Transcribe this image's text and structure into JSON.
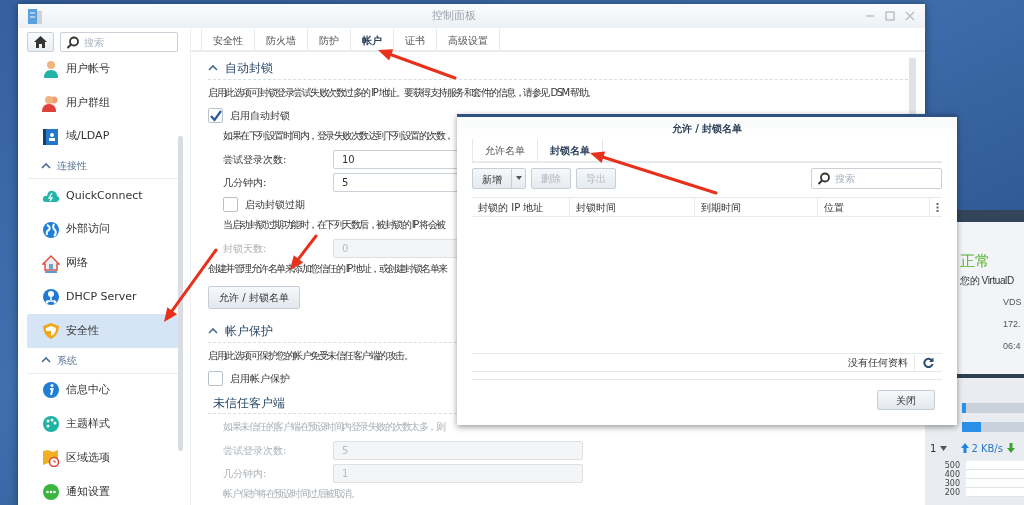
{
  "main_window": {
    "title": "控制面板"
  },
  "sidebar": {
    "search": {
      "placeholder": "搜索"
    },
    "items": [
      {
        "kind": "item",
        "label": "用户帐号",
        "selected": false
      },
      {
        "kind": "item",
        "label": "用户群组",
        "selected": false
      },
      {
        "kind": "item",
        "label": "域/LDAP",
        "selected": false
      },
      {
        "kind": "header",
        "label": "连接性",
        "expanded": true
      },
      {
        "kind": "item",
        "label": "QuickConnect",
        "selected": false
      },
      {
        "kind": "item",
        "label": "外部访问",
        "selected": false
      },
      {
        "kind": "item",
        "label": "网络",
        "selected": false
      },
      {
        "kind": "item",
        "label": "DHCP Server",
        "selected": false
      },
      {
        "kind": "item",
        "label": "安全性",
        "selected": true
      },
      {
        "kind": "header",
        "label": "系统",
        "expanded": true
      },
      {
        "kind": "item",
        "label": "信息中心",
        "selected": false
      },
      {
        "kind": "item",
        "label": "主题样式",
        "selected": false
      },
      {
        "kind": "item",
        "label": "区域选项",
        "selected": false
      },
      {
        "kind": "item",
        "label": "通知设置",
        "selected": false
      }
    ]
  },
  "tabs": [
    {
      "label": "安全性",
      "selected": false
    },
    {
      "label": "防火墙",
      "selected": false
    },
    {
      "label": "防护",
      "selected": false
    },
    {
      "label": "帐户",
      "selected": true
    },
    {
      "label": "证书",
      "selected": false
    },
    {
      "label": "高级设置",
      "selected": false
    }
  ],
  "content": [
    {
      "kind": "section",
      "title": "自动封锁",
      "expanded": true
    },
    {
      "kind": "text",
      "text": "启用此选项可封锁登录尝试失败次数过多的 IP 地址。要获得支持服务和套件的信息，请参见 DSM 帮助。",
      "disabled": false
    },
    {
      "kind": "checkbox",
      "label": "启用自动封锁",
      "checked": true,
      "children": [
        {
          "kind": "text",
          "text": "如果在下列设置时间内，登录失败次数达到下列设置的次数，",
          "disabled": false
        },
        {
          "kind": "field",
          "label": "尝试登录次数:",
          "value": "10",
          "disabled": false
        },
        {
          "kind": "field",
          "label": "几分钟内:",
          "value": "5",
          "disabled": false
        },
        {
          "kind": "checkbox",
          "label": "启动封锁过期",
          "checked": false
        },
        {
          "kind": "text",
          "text": "当启动封锁过期功能时，在下列天数后，被封锁的 IP 将会被",
          "disabled": false
        },
        {
          "kind": "field",
          "label": "封锁天数:",
          "value": "0",
          "disabled": true
        }
      ]
    },
    {
      "kind": "text",
      "text": "创建并管理允许名单来添加您信任的 IP 地址，或创建封锁名单来",
      "disabled": false
    },
    {
      "kind": "button",
      "label": "允许 / 封锁名单"
    },
    {
      "kind": "section",
      "title": "帐户保护",
      "expanded": true
    },
    {
      "kind": "text",
      "text": "启用此选项可保护您的帐户免受未信任客户端的攻击。",
      "disabled": false
    },
    {
      "kind": "checkbox",
      "label": "启用帐户保护",
      "checked": false
    },
    {
      "kind": "subheading",
      "title": "未信任客户端",
      "children": [
        {
          "kind": "text",
          "text": "如果未信任的客户端在预设时间内登录失败的次数太多，则",
          "disabled": true
        },
        {
          "kind": "field",
          "label": "尝试登录次数:",
          "value": "5",
          "disabled": true
        },
        {
          "kind": "field",
          "label": "几分钟内:",
          "value": "1",
          "disabled": true
        },
        {
          "kind": "text",
          "text": "帐户保护将在预设时间过后被取消。",
          "disabled": true
        }
      ]
    }
  ],
  "dialog": {
    "title": "允许 / 封锁名单",
    "tabs": [
      {
        "label": "允许名单",
        "selected": false
      },
      {
        "label": "封锁名单",
        "selected": true
      }
    ],
    "toolbar": [
      {
        "kind": "split",
        "label": "新增",
        "disabled": false
      },
      {
        "kind": "button",
        "label": "删除",
        "disabled": true
      },
      {
        "kind": "button",
        "label": "导出",
        "disabled": true
      }
    ],
    "search": {
      "placeholder": "搜索"
    },
    "columns": [
      "封锁的 IP 地址",
      "封锁时间",
      "到期时间",
      "位置"
    ],
    "status": "没有任何资料",
    "close_button": "关闭"
  },
  "widget": {
    "status": "正常",
    "message": "您的 VirtualD",
    "info": [
      "VDS",
      "172.",
      "06:4"
    ],
    "meters": [
      {
        "level": 0.06
      },
      {
        "level": 0.3
      }
    ],
    "selector": "1",
    "upload": "2 KB/s",
    "axis_labels": [
      "500",
      "400",
      "300",
      "200"
    ]
  }
}
